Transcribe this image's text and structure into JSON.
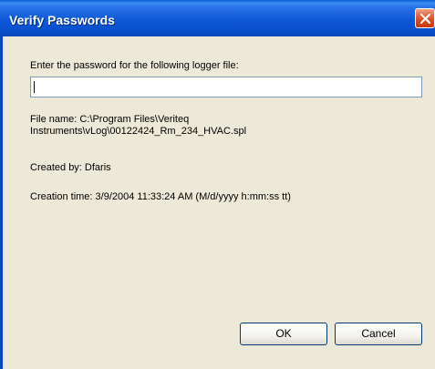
{
  "dialog": {
    "title": "Verify Passwords",
    "prompt": "Enter the password for the following logger file:",
    "password_value": "",
    "file_name_line1": "File name: C:\\Program Files\\Veriteq",
    "file_name_line2": "Instruments\\vLog\\00122424_Rm_234_HVAC.spl",
    "created_by": "Created by: Dfaris",
    "creation_time": "Creation time: 3/9/2004 11:33:24 AM (M/d/yyyy h:mm:ss tt)",
    "ok_label": "OK",
    "cancel_label": "Cancel"
  },
  "colors": {
    "titlebar": "#0a58d6",
    "client_bg": "#ece9d8",
    "close_button": "#d6451b"
  },
  "icons": {
    "close": "close-icon"
  }
}
